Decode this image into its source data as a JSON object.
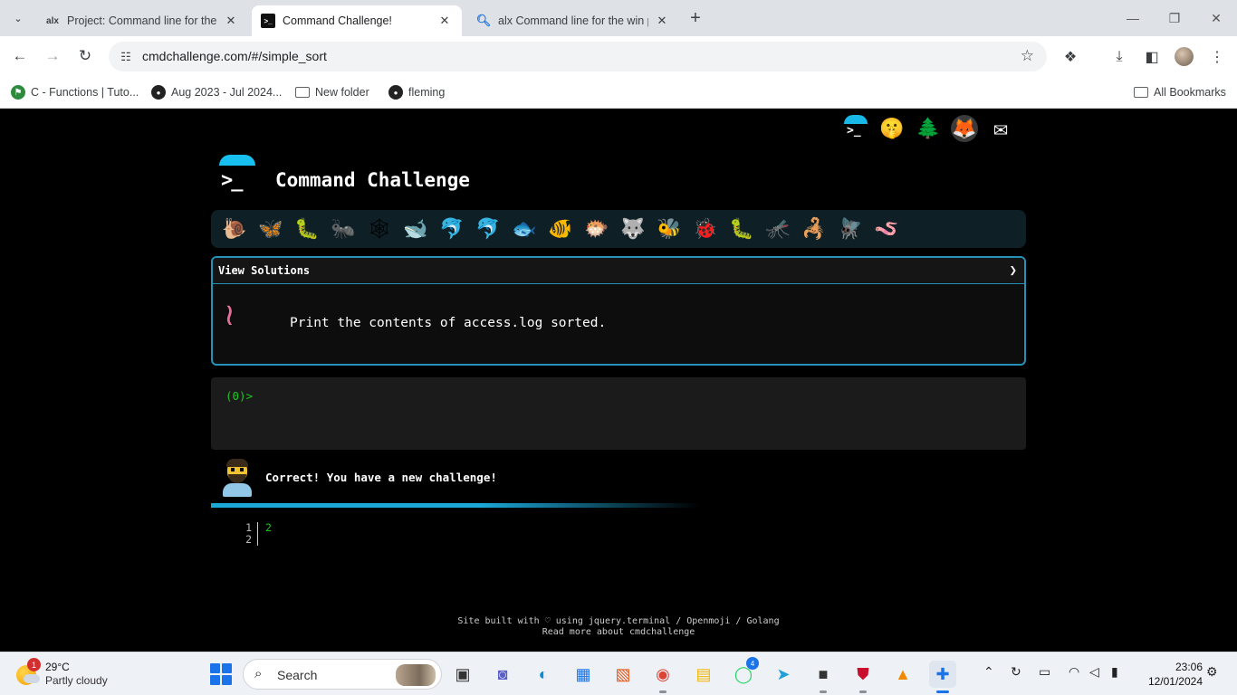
{
  "browser": {
    "tabs": [
      {
        "favicon": "alx",
        "title": "Project: Command line for the w",
        "active": false
      },
      {
        "favicon": ">_",
        "title": "Command Challenge!",
        "active": true
      },
      {
        "favicon": "search-icon",
        "title": "alx Command line for the win p",
        "active": false
      }
    ],
    "url": "cmdchallenge.com/#/simple_sort",
    "bookmarks": [
      {
        "icon": "green-logo",
        "label": "C - Functions | Tuto..."
      },
      {
        "icon": "github-icon",
        "label": "Aug 2023 - Jul 2024..."
      },
      {
        "icon": "folder-icon",
        "label": "New folder"
      },
      {
        "icon": "github-icon",
        "label": "fleming"
      }
    ],
    "all_bookmarks": "All Bookmarks"
  },
  "page": {
    "brand_title": "Command Challenge",
    "brand_prompt": ">_",
    "top_icons": [
      "terminal-logo",
      "shushing-face",
      "tree",
      "gitlab",
      "envelope"
    ],
    "animals": [
      "🐌",
      "🦋",
      "🐛",
      "🐜",
      "🕸",
      "🐋",
      "🐬",
      "🐬",
      "🐟",
      "🐠",
      "🐡",
      "🐺",
      "🐝",
      "🐞",
      "🐛",
      "🦟",
      "🦂",
      "🪰",
      "🪱"
    ],
    "view_solutions": "View Solutions",
    "task_icon": "worm",
    "task": "Print the contents of access.log sorted.",
    "prompt": "(0)>",
    "feedback": "Correct! You have a new challenge!",
    "output_line_numbers": "1\n2",
    "output_values": "2",
    "footer_line1": "Site built with ♡ using jquery.terminal / Openmoji / Golang",
    "footer_line2": "Read more about cmdchallenge"
  },
  "taskbar": {
    "weather_temp": "29°C",
    "weather_cond": "Partly cloudy",
    "weather_badge": "1",
    "search_placeholder": "Search",
    "whatsapp_badge": "4",
    "time": "23:06",
    "date": "12/01/2024"
  },
  "colors": {
    "accent": "#18b8e8",
    "terminal_green": "#21c521",
    "box_border": "#2590b8"
  }
}
